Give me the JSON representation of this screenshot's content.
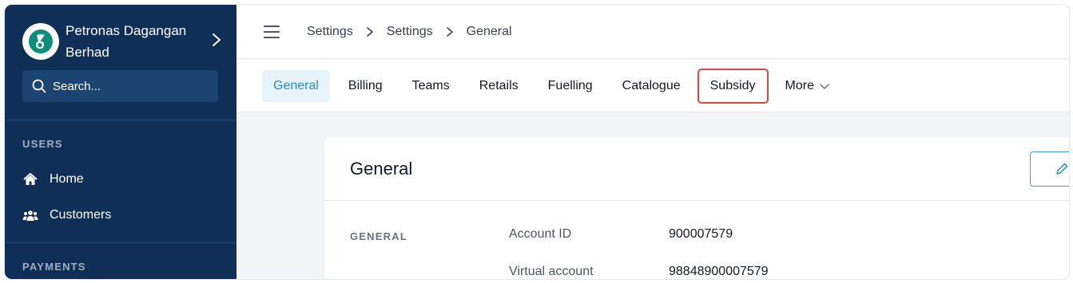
{
  "sidebar": {
    "org_name": "Petronas Dagangan Berhad",
    "search_placeholder": "Search...",
    "sections": [
      {
        "label": "USERS",
        "items": [
          {
            "label": "Home",
            "icon": "home-icon"
          },
          {
            "label": "Customers",
            "icon": "users-icon"
          }
        ]
      },
      {
        "label": "PAYMENTS",
        "items": []
      }
    ]
  },
  "topbar": {
    "breadcrumb": [
      "Settings",
      "Settings",
      "General"
    ]
  },
  "tabs": [
    {
      "label": "General",
      "active": true
    },
    {
      "label": "Billing"
    },
    {
      "label": "Teams"
    },
    {
      "label": "Retails"
    },
    {
      "label": "Fuelling"
    },
    {
      "label": "Catalogue"
    },
    {
      "label": "Subsidy",
      "highlighted": true
    },
    {
      "label": "More",
      "dropdown": true
    }
  ],
  "card": {
    "title": "General",
    "group_label": "GENERAL",
    "fields": [
      {
        "label": "Account ID",
        "value": "900007579"
      },
      {
        "label": "Virtual account",
        "value": "98848900007579"
      }
    ]
  },
  "colors": {
    "sidebar_bg": "#0f2f57",
    "accent": "#1d8fd1",
    "highlight_border": "#e0473c"
  }
}
